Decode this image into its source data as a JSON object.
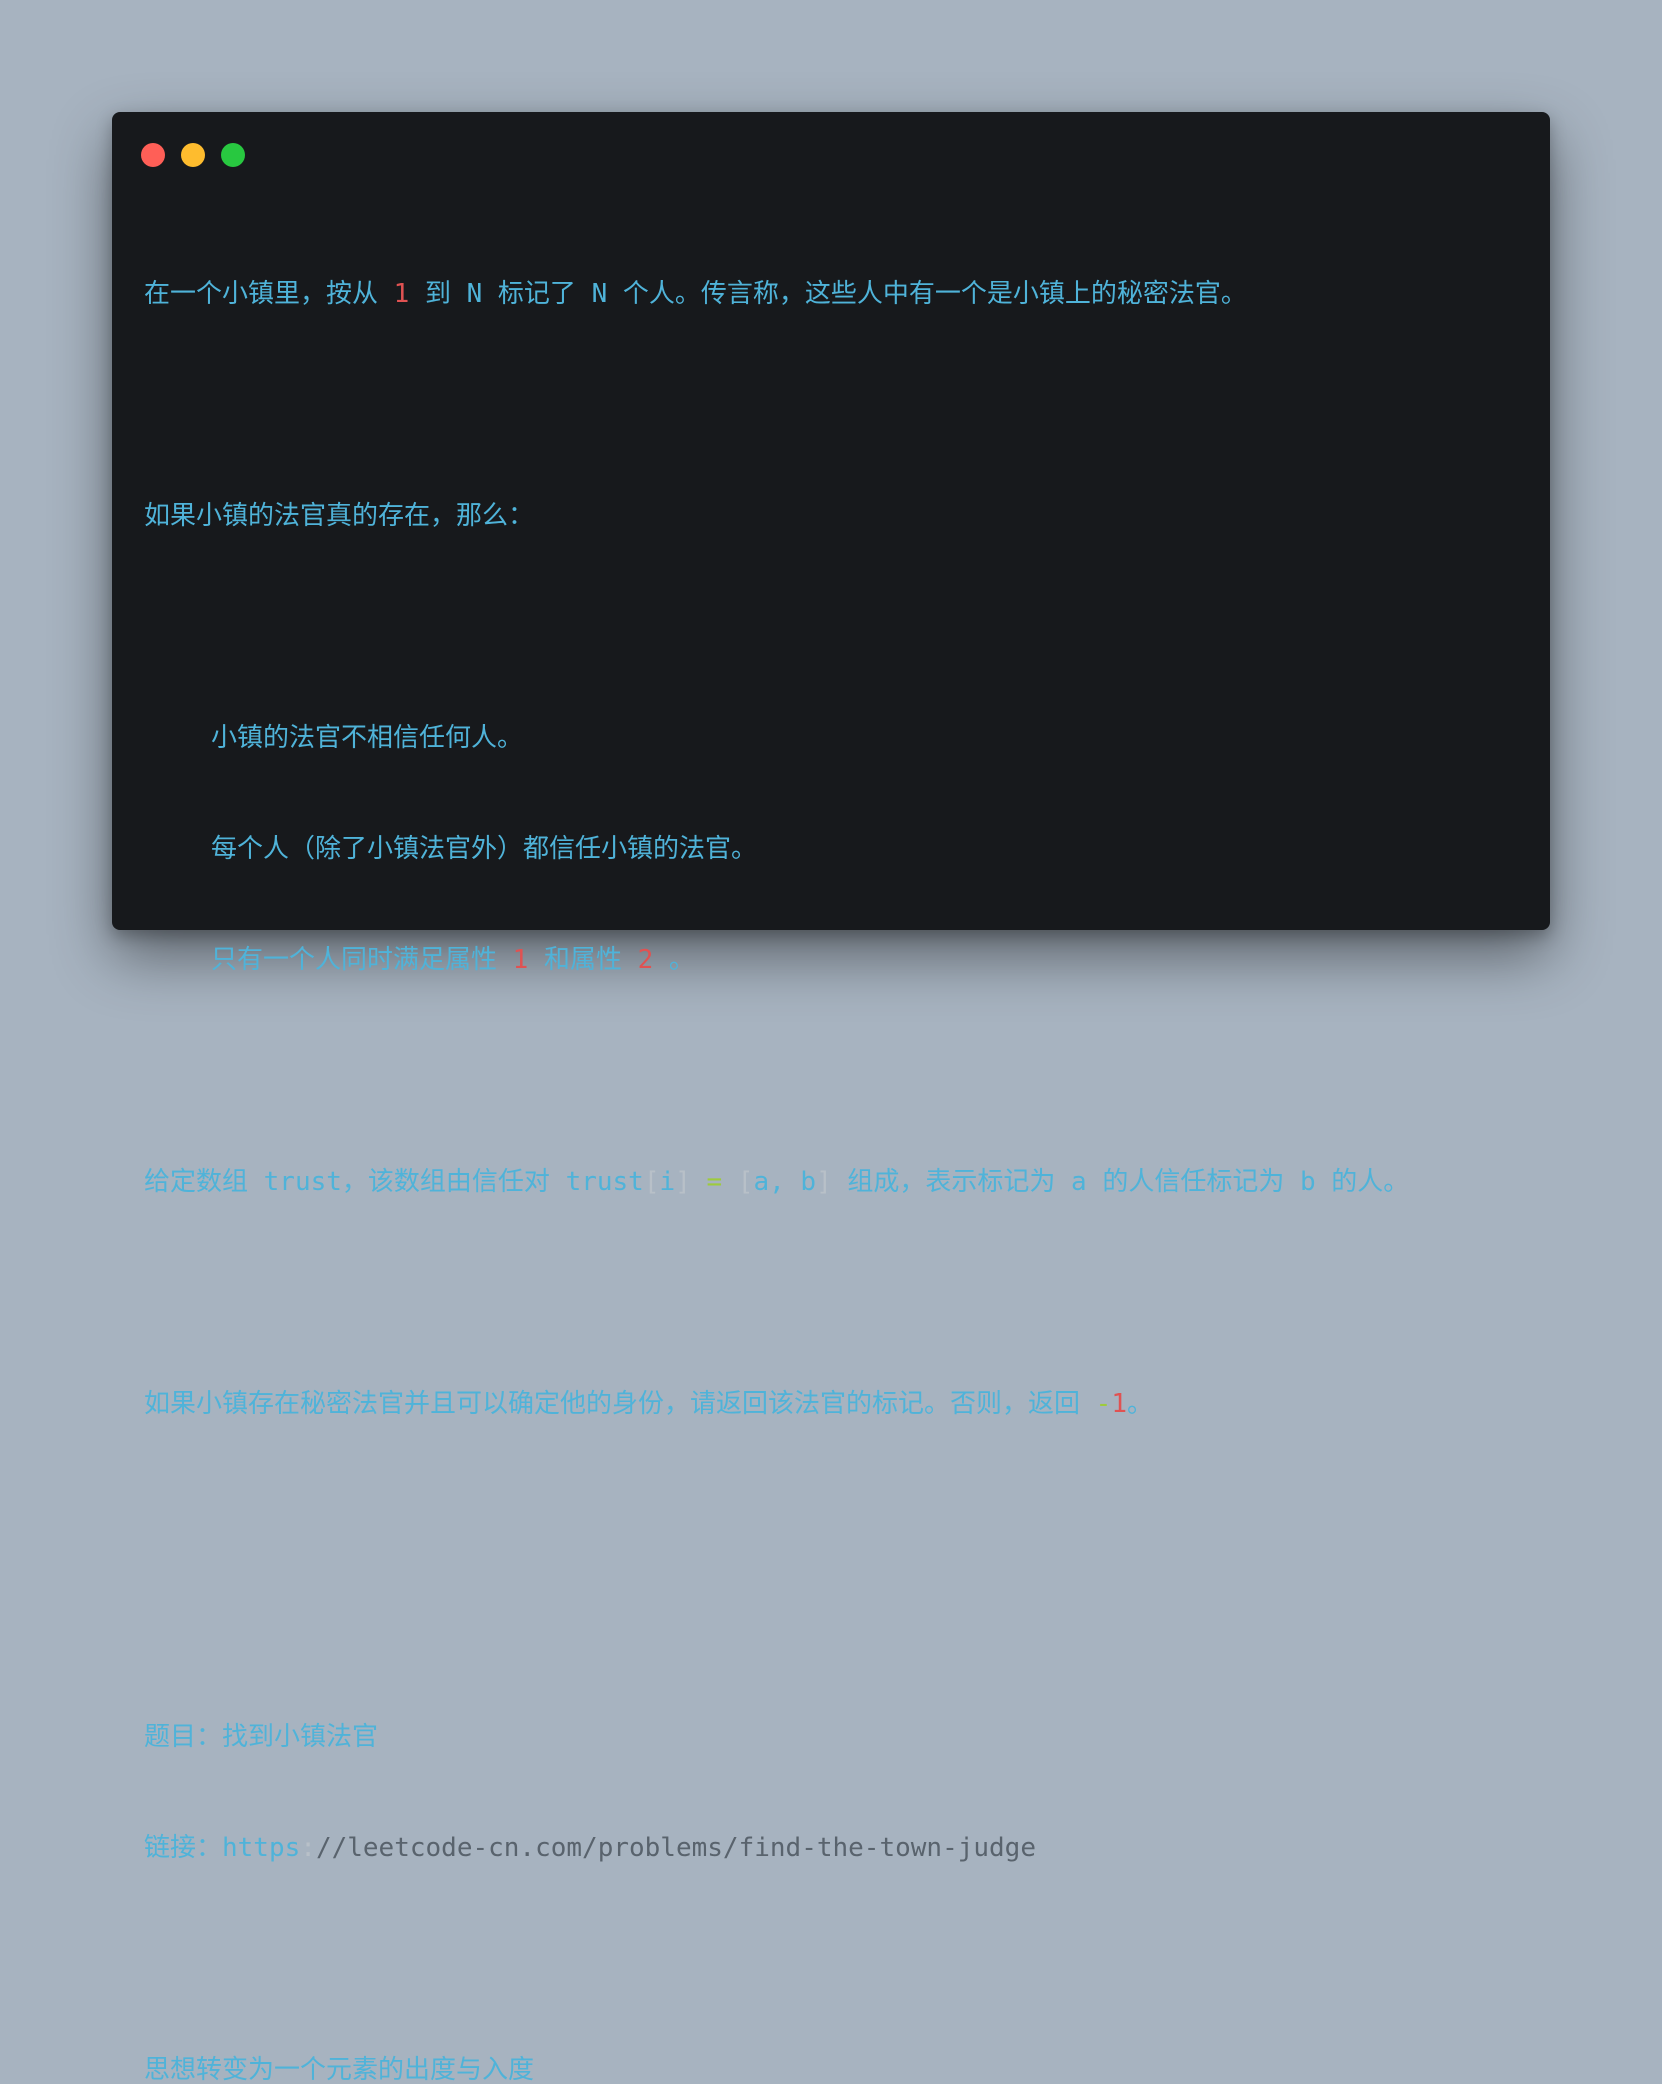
{
  "window": {
    "controls": [
      "close",
      "minimize",
      "maximize"
    ]
  },
  "colors": {
    "background": "#a7b3c0",
    "window": "#17191c",
    "text": "#4fb3d9",
    "number": "#e05252",
    "operator": "#9ecb3c",
    "link_dim": "#59636d"
  },
  "lines": {
    "l1_a": "在一个小镇里，按从 ",
    "l1_num1": "1",
    "l1_b": " 到 N 标记了 N 个人。传言称，这些人中有一个是小镇上的秘密法官。",
    "l2": "如果小镇的法官真的存在，那么：",
    "l3": "小镇的法官不相信任何人。",
    "l4": "每个人（除了小镇法官外）都信任小镇的法官。",
    "l5_a": "只有一个人同时满足属性 ",
    "l5_num1": "1",
    "l5_b": " 和属性 ",
    "l5_num2": "2",
    "l5_c": " 。",
    "l6_a": "给定数组 trust，该数组由信任对 trust",
    "l6_b1": "[",
    "l6_b2": "i",
    "l6_b3": "]",
    "l6_eq": " = ",
    "l6_c1": "[",
    "l6_c2": "a, b",
    "l6_c3": "]",
    "l6_d": " 组成，表示标记为 a 的人信任标记为 b 的人。",
    "l7_a": "如果小镇存在秘密法官并且可以确定他的身份，请返回该法官的标记。否则，返回 ",
    "l7_minus": "-",
    "l7_num": "1",
    "l7_b": "。",
    "l8": "题目：找到小镇法官",
    "l9_a": "链接：https",
    "l9_colon": ":",
    "l9_b": "//leetcode-cn.com/problems/find-the-town-judge",
    "l10": "思想转变为一个元素的出度与入度"
  }
}
